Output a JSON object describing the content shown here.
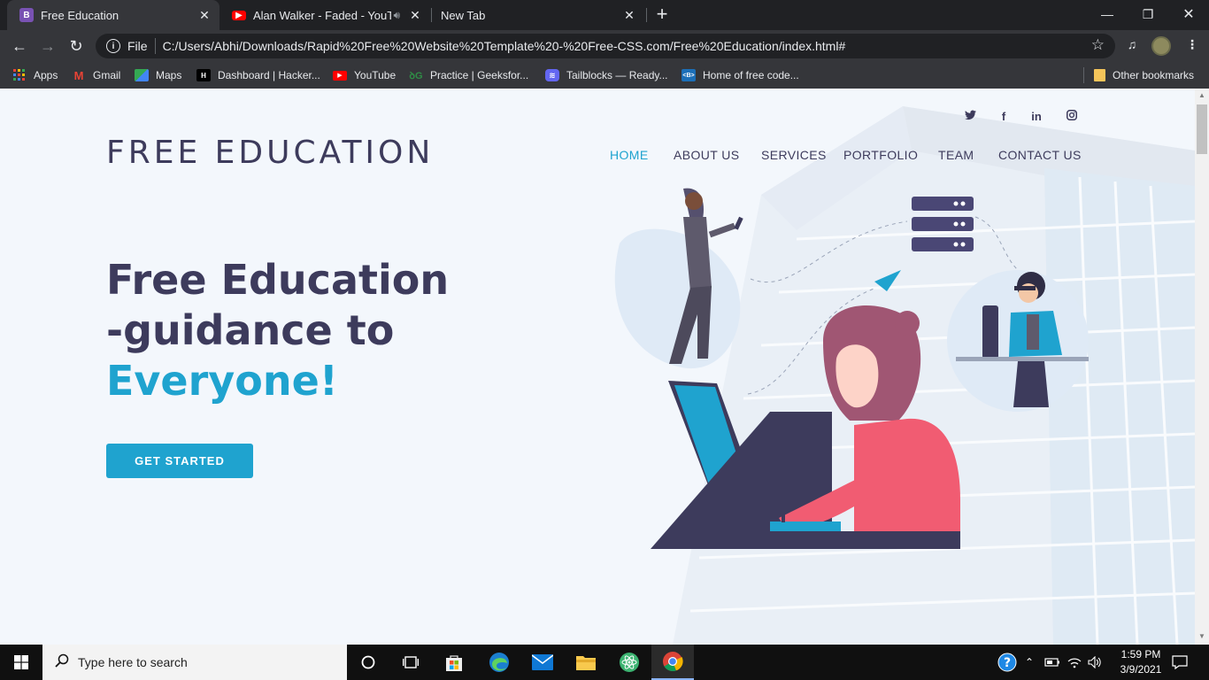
{
  "browser": {
    "tabs": [
      {
        "title": "Free Education",
        "favicon": "bootstrap-icon",
        "active": true
      },
      {
        "title": "Alan Walker - Faded - YouTube",
        "favicon": "youtube-icon",
        "active": false
      },
      {
        "title": "New Tab",
        "favicon": "",
        "active": false
      }
    ],
    "address": {
      "scheme_label": "File",
      "url": "C:/Users/Abhi/Downloads/Rapid%20Free%20Website%20Template%20-%20Free-CSS.com/Free%20Education/index.html#"
    },
    "bookmarks": [
      {
        "label": "Apps",
        "icon": "apps-grid-icon"
      },
      {
        "label": "Gmail",
        "icon": "gmail-icon"
      },
      {
        "label": "Maps",
        "icon": "maps-icon"
      },
      {
        "label": "Dashboard | Hacker...",
        "icon": "hackerrank-icon"
      },
      {
        "label": "YouTube",
        "icon": "youtube-icon"
      },
      {
        "label": "Practice | Geeksfor...",
        "icon": "geeksforgeeks-icon"
      },
      {
        "label": "Tailblocks — Ready...",
        "icon": "tailblocks-icon"
      },
      {
        "label": "Home of free code...",
        "icon": "freecodecamp-icon"
      }
    ],
    "other_bookmarks": "Other bookmarks"
  },
  "site": {
    "logo": "FREE EDUCATION",
    "social": [
      "twitter-icon",
      "facebook-icon",
      "linkedin-icon",
      "instagram-icon"
    ],
    "nav": [
      {
        "label": "HOME",
        "active": true
      },
      {
        "label": "ABOUT US",
        "active": false
      },
      {
        "label": "SERVICES",
        "active": false
      },
      {
        "label": "PORTFOLIO",
        "active": false
      },
      {
        "label": "TEAM",
        "active": false
      },
      {
        "label": "CONTACT US",
        "active": false
      }
    ],
    "hero": {
      "line1": "Free Education",
      "line2": "-guidance to",
      "line3": "Everyone!",
      "cta": "GET STARTED"
    },
    "colors": {
      "primary": "#3d3b5c",
      "accent": "#1fa3cf",
      "background": "#f3f7fc"
    }
  },
  "taskbar": {
    "search_placeholder": "Type here to search",
    "time": "1:59 PM",
    "date": "3/9/2021"
  }
}
